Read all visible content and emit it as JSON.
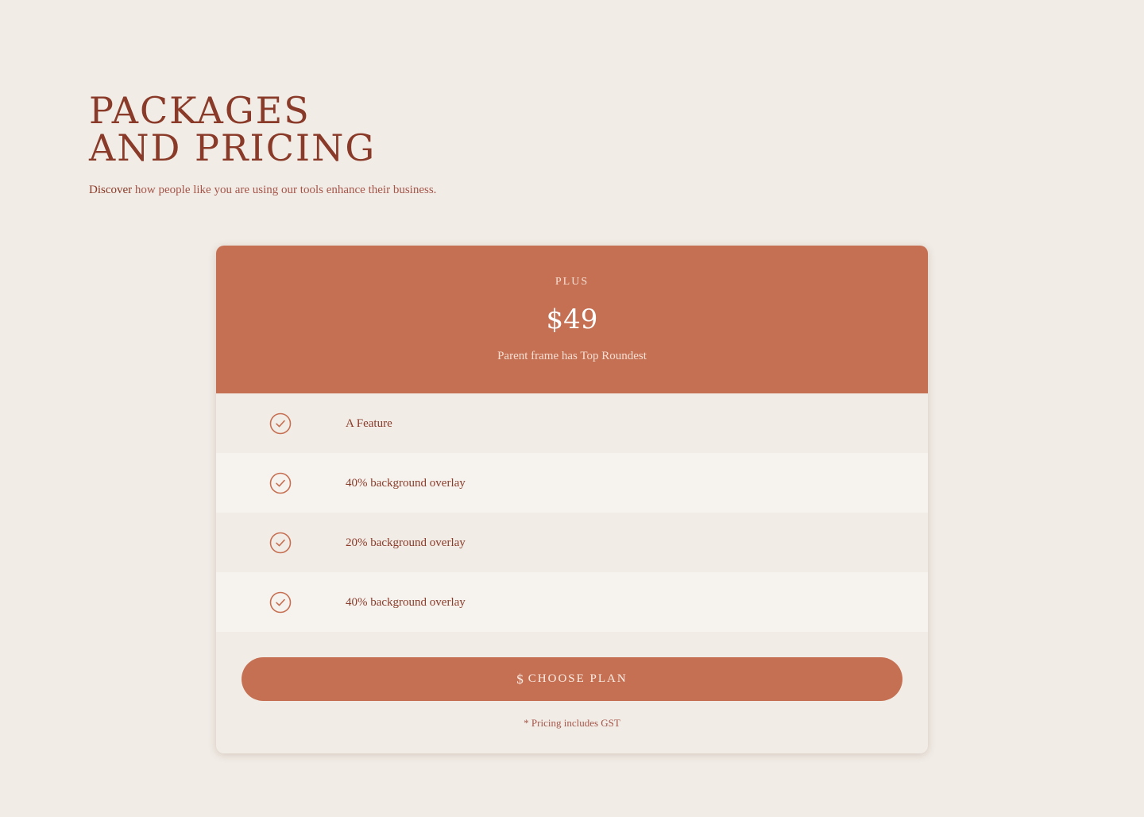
{
  "header": {
    "title_line1": "PACKAGES",
    "title_line2": "AND PRICING",
    "subtitle_lead": "Discover",
    "subtitle_rest": " how people like you are using our tools enhance their business."
  },
  "card": {
    "plan_name": "PLUS",
    "price": "$49",
    "note": "Parent frame has Top Roundest",
    "features": [
      {
        "label": "A Feature",
        "icon": "check-circle-icon"
      },
      {
        "label": "40% background overlay",
        "icon": "check-circle-icon"
      },
      {
        "label": "20% background overlay",
        "icon": "check-circle-icon"
      },
      {
        "label": "40% background overlay",
        "icon": "check-circle-icon"
      }
    ],
    "button_icon": "$",
    "button_label": "CHOOSE PLAN",
    "footnote": "* Pricing includes GST"
  },
  "colors": {
    "background": "#f1ece6",
    "accent": "#c67053",
    "text": "#8a3a28",
    "row_alt": "#f6f3ef"
  }
}
